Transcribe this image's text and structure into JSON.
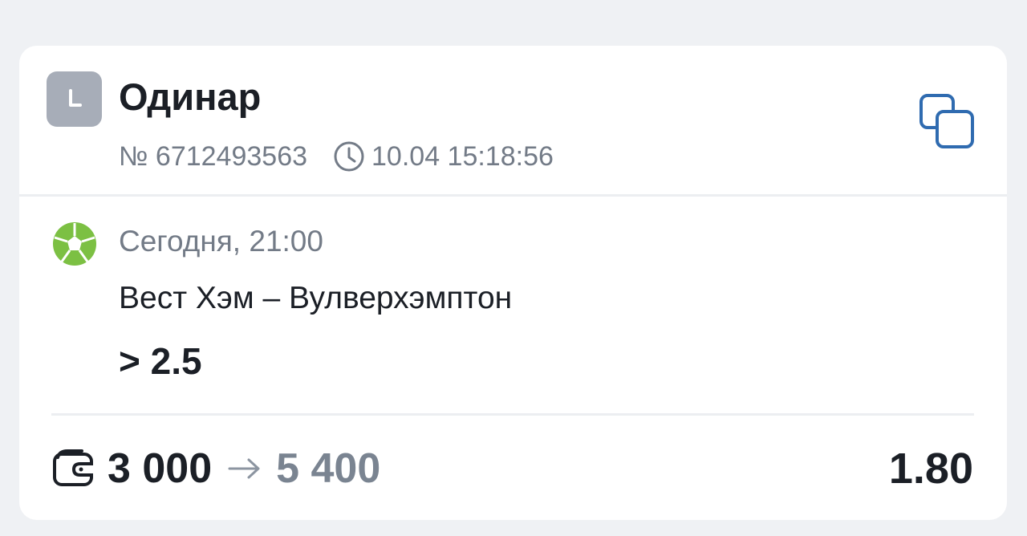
{
  "bet": {
    "type_label": "Одинар",
    "number": "№ 6712493563",
    "placed_at": "10.04 15:18:56",
    "status_icon": "clock-icon"
  },
  "event": {
    "time": "Сегодня, 21:00",
    "teams": "Вест Хэм – Вулверхэмптон",
    "outcome": "> 2.5",
    "sport_icon": "soccer-ball-icon"
  },
  "footer": {
    "stake": "3 000",
    "payout": "5 400",
    "coefficient": "1.80"
  },
  "colors": {
    "accent": "#2f6bb0",
    "sport_green": "#7cc043",
    "muted": "#737b87",
    "text": "#1b1f26",
    "status_bg": "#a7adb8"
  }
}
